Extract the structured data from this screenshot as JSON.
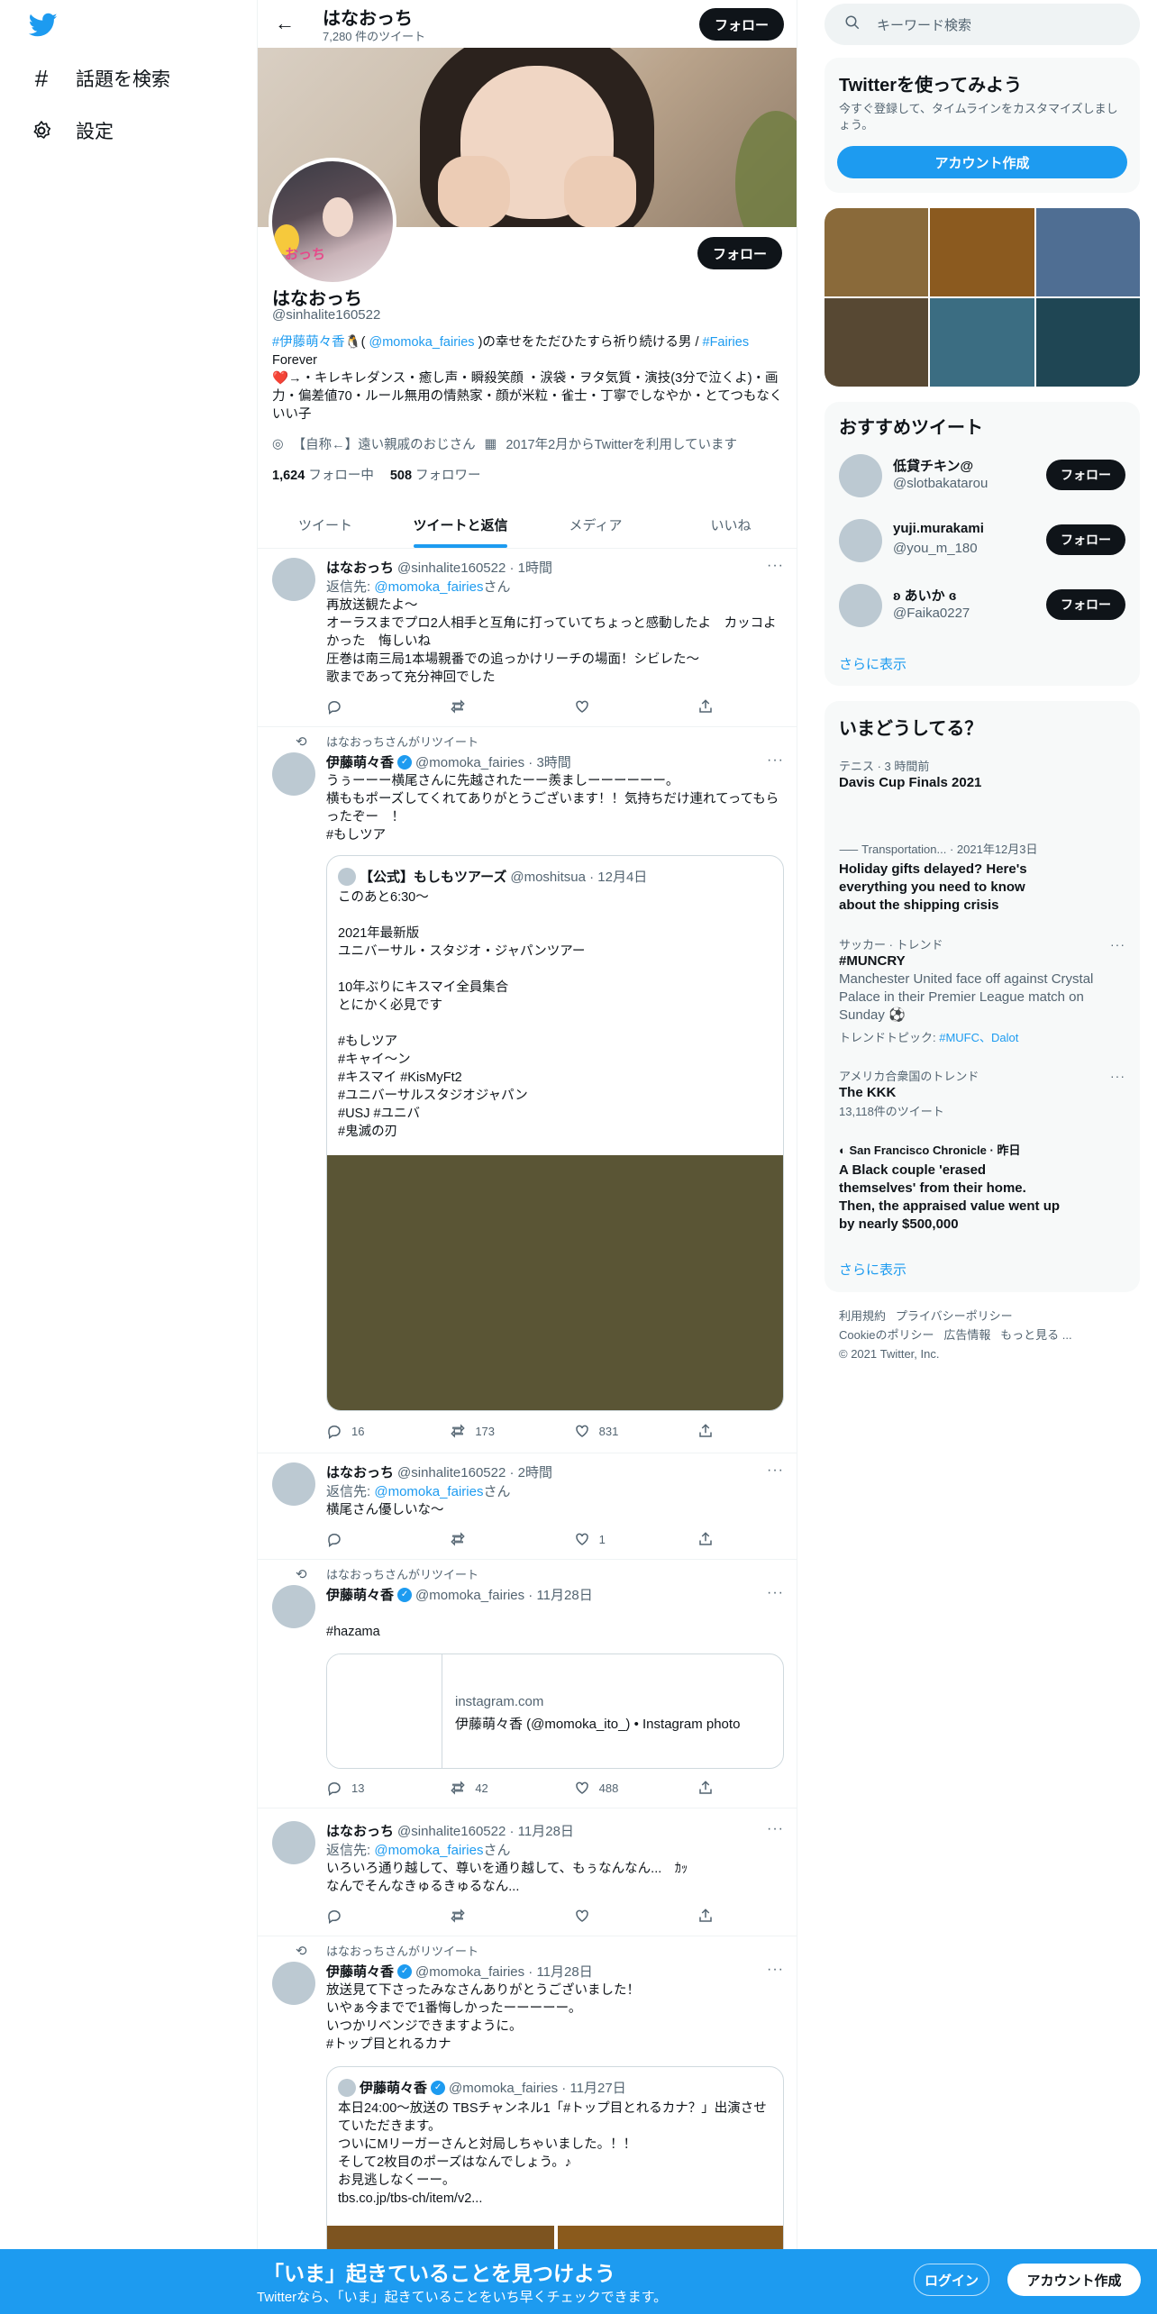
{
  "nav": {
    "explore": "話題を検索",
    "settings": "設定"
  },
  "header": {
    "name": "はなおっち",
    "tweet_count": "7,280 件のツイート",
    "follow": "フォロー"
  },
  "profile": {
    "name": "はなおっち",
    "handle": "@sinhalite160522",
    "follow": "フォロー",
    "bio_tag1": "#伊藤萌々香",
    "bio_mid1": "( ",
    "bio_mention": "@momoka_fairies",
    "bio_mid2": " )の幸せをただひたすら祈り続ける男 / ",
    "bio_tag2": "#Fairies",
    "bio_line2": "Forever",
    "bio_rest": "→・キレキレダンス・癒し声・瞬殺笑顔 ・涙袋・ヲタ気質・演技(3分で泣くよ)・画力・偏差値70・ルール無用の情熱家・顔が米粒・雀士・丁寧でしなやか・とてつもなくいい子",
    "location": "【自称←】遠い親戚のおじさん",
    "joined": "2017年2月からTwitterを利用しています",
    "following_count": "1,624",
    "following_label": "フォロー中",
    "followers_count": "508",
    "followers_label": "フォロワー",
    "avatar_sticker": "おっち"
  },
  "tabs": [
    "ツイート",
    "ツイートと返信",
    "メディア",
    "いいね"
  ],
  "tweets": [
    {
      "name": "はなおっち",
      "meta": "@sinhalite160522 · 1時間",
      "reply_prefix": "返信先: ",
      "reply_to": "@momoka_fairies",
      "reply_suffix": "さん",
      "text": "再放送観たよ〜\nオーラスまでプロ2人相手と互角に打っていてちょっと感動したよ　カッコよかった　悔しいね\n圧巻は南三局1本場親番での追っかけリーチの場面！シビレた〜\n歌まであって充分神回でした"
    },
    {
      "retweet_by": "はなおっちさんがリツイート",
      "name": "伊藤萌々香",
      "meta": "@momoka_fairies · 3時間",
      "text": "うぅーーー横尾さんに先越されたーー羨ましーーーーーー。\n横ももポーズしてくれてありがとうございます！！気持ちだけ連れてってもらったぞー　！",
      "hashtag": "#もしツア",
      "quote_name": "【公式】もしもツアーズ",
      "quote_meta": "@moshitsua · 12月4日",
      "quote_text": "このあと6:30〜\n\n2021年最新版\nユニバーサル・スタジオ・ジャパンツアー\n\n10年ぶりにキスマイ全員集合\nとにかく必見です\n\n#もしツア\n#キャイ〜ン\n#キスマイ #KisMyFt2\n#ユニバーサルスタジオジャパン\n#USJ #ユニバ\n#鬼滅の刃",
      "replies": "16",
      "retweets": "173",
      "likes": "831"
    },
    {
      "name": "はなおっち",
      "meta": "@sinhalite160522 · 2時間",
      "reply_prefix": "返信先: ",
      "reply_to": "@momoka_fairies",
      "reply_suffix": "さん",
      "text": "横尾さん優しいな〜",
      "likes": "1"
    },
    {
      "retweet_by": "はなおっちさんがリツイート",
      "name": "伊藤萌々香",
      "meta": "@momoka_fairies · 11月28日",
      "hashtag": "#hazama",
      "link_domain": "instagram.com",
      "link_title": "伊藤萌々香 (@momoka_ito_) • Instagram photo",
      "replies": "13",
      "retweets": "42",
      "likes": "488"
    },
    {
      "name": "はなおっち",
      "meta": "@sinhalite160522 · 11月28日",
      "reply_prefix": "返信先: ",
      "reply_to": "@momoka_fairies",
      "reply_suffix": "さん",
      "text": "いろいろ通り越して、尊いを通り越して、もぅなんなん...　ｶｯ\nなんでそんなきゅるきゅるなん..."
    },
    {
      "retweet_by": "はなおっちさんがリツイート",
      "name": "伊藤萌々香",
      "meta": "@momoka_fairies · 11月28日",
      "text": "放送見て下さったみなさんありがとうございました！\nいやぁ今までで1番悔しかったーーーーー。\nいつかリベンジできますように。",
      "hashtag": "#トップ目とれるカナ",
      "quote_name": "伊藤萌々香",
      "quote_meta": "@momoka_fairies · 11月27日",
      "quote_text": "本日24:00〜放送の TBSチャンネル1「#トップ目とれるカナ？」出演させていただきます。\nついにMリーガーさんと対局しちゃいました。！！\nそして2枚目のポーズはなんでしょう。♪\nお見逃しなくーー。\ntbs.co.jp/tbs-ch/item/v2..."
    }
  ],
  "right": {
    "search_placeholder": "キーワード検索",
    "signup_title": "Twitterを使ってみよう",
    "signup_sub": "今すぐ登録して、タイムラインをカスタマイズしましょう。",
    "signup_button": "アカウント作成",
    "media_colors": [
      "#8a6a3a",
      "#8b5a1f",
      "#4f6e93",
      "#574833",
      "#3b6d82",
      "#1f4654"
    ],
    "recommended_title": "おすすめツイート",
    "recommended": [
      {
        "name": "低貸チキン@",
        "handle": "@slotbakatarou"
      },
      {
        "name": "yuji.murakami",
        "handle": "@you_m_180"
      },
      {
        "name": "ʚ あいか ɞ",
        "handle": "@Faika0227"
      }
    ],
    "follow_label": "フォロー",
    "show_more": "さらに表示",
    "trends_title": "いまどうしてる？",
    "trends": [
      {
        "cat": "テニス · 3 時間前",
        "title": "Davis Cup Finals 2021"
      },
      {
        "cat": "Transportation... · 2021年12月3日",
        "title": "Holiday gifts delayed? Here's everything you need to know about the shipping crisis"
      },
      {
        "cat": "サッカー · トレンド",
        "title": "#MUNCRY",
        "desc": "Manchester United face off against Crystal Palace in their Premier League match on Sunday ⚽",
        "topics_label": "トレンドトピック: ",
        "topics": "#MUFC、Dalot"
      },
      {
        "cat": "アメリカ合衆国のトレンド",
        "title": "The KKK",
        "count": "13,118件のツイート"
      },
      {
        "cat": "San Francisco Chronicle · 昨日",
        "title": "A Black couple 'erased themselves' from their home. Then, the appraised value went up by nearly $500,000"
      }
    ],
    "trends_more": "さらに表示",
    "footer": [
      "利用規約",
      "プライバシーポリシー",
      "Cookieのポリシー",
      "広告情報",
      "もっと見る ...",
      "© 2021 Twitter, Inc."
    ]
  },
  "bottom": {
    "title": "「いま」起きていることを見つけよう",
    "sub": "Twitterなら、「いま」起きていることをいち早くチェックできます。",
    "login": "ログイン",
    "signup": "アカウント作成"
  }
}
